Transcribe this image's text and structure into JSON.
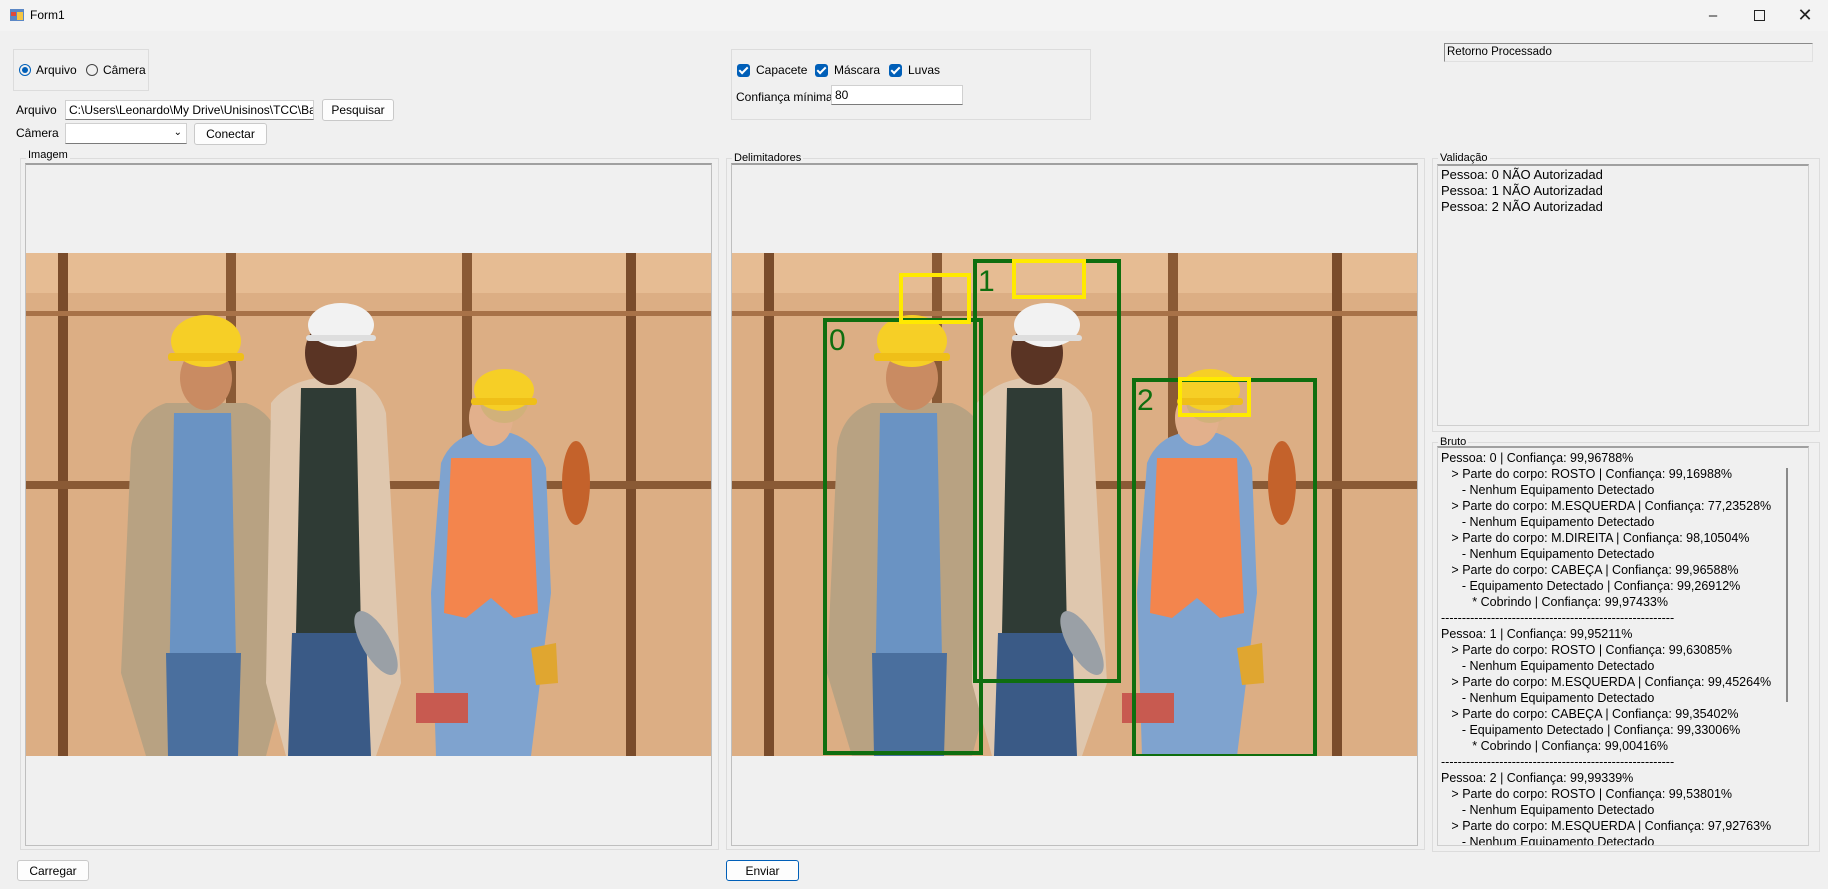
{
  "window": {
    "title": "Form1"
  },
  "source": {
    "options": [
      {
        "label": "Arquivo",
        "selected": true
      },
      {
        "label": "Câmera",
        "selected": false
      }
    ]
  },
  "file": {
    "label": "Arquivo",
    "path": "C:\\Users\\Leonardo\\My Drive\\Unisinos\\TCC\\Banco",
    "search_button": "Pesquisar"
  },
  "camera": {
    "label": "Câmera",
    "selected": "",
    "connect_button": "Conectar"
  },
  "filters": {
    "checks": [
      {
        "label": "Capacete",
        "checked": true
      },
      {
        "label": "Máscara",
        "checked": true
      },
      {
        "label": "Luvas",
        "checked": true
      }
    ],
    "min_confidence_label": "Confiança mínima",
    "min_confidence_value": "80"
  },
  "status": {
    "text": "Retorno Processado"
  },
  "panels": {
    "image": "Imagem",
    "bounds": "Delimitadores",
    "validation": "Validação",
    "raw": "Bruto"
  },
  "detections": {
    "box_color": "#0f6e0f",
    "helmet_color": "#ffea00",
    "person_ids": [
      "0",
      "1",
      "2"
    ]
  },
  "validation": {
    "lines": [
      "Pessoa: 0 NÃO Autorizadad",
      "Pessoa: 1 NÃO Autorizadad",
      "Pessoa: 2 NÃO Autorizadad"
    ]
  },
  "raw": {
    "lines": [
      "Pessoa: 0 | Confiança: 99,96788%",
      "   > Parte do corpo: ROSTO | Confiança: 99,16988%",
      "      - Nenhum Equipamento Detectado",
      "   > Parte do corpo: M.ESQUERDA | Confiança: 77,23528%",
      "      - Nenhum Equipamento Detectado",
      "   > Parte do corpo: M.DIREITA | Confiança: 98,10504%",
      "      - Nenhum Equipamento Detectado",
      "   > Parte do corpo: CABEÇA | Confiança: 99,96588%",
      "      - Equipamento Detectado | Confiança: 99,26912%",
      "         * Cobrindo | Confiança: 99,97433%",
      "--------------------------------------------------------",
      "Pessoa: 1 | Confiança: 99,95211%",
      "   > Parte do corpo: ROSTO | Confiança: 99,63085%",
      "      - Nenhum Equipamento Detectado",
      "   > Parte do corpo: M.ESQUERDA | Confiança: 99,45264%",
      "      - Nenhum Equipamento Detectado",
      "   > Parte do corpo: CABEÇA | Confiança: 99,35402%",
      "      - Equipamento Detectado | Confiança: 99,33006%",
      "         * Cobrindo | Confiança: 99,00416%",
      "--------------------------------------------------------",
      "Pessoa: 2 | Confiança: 99,99339%",
      "   > Parte do corpo: ROSTO | Confiança: 99,53801%",
      "      - Nenhum Equipamento Detectado",
      "   > Parte do corpo: M.ESQUERDA | Confiança: 97,92763%",
      "      - Nenhum Equipamento Detectado"
    ]
  },
  "footer": {
    "load_button": "Carregar",
    "send_button": "Enviar"
  }
}
